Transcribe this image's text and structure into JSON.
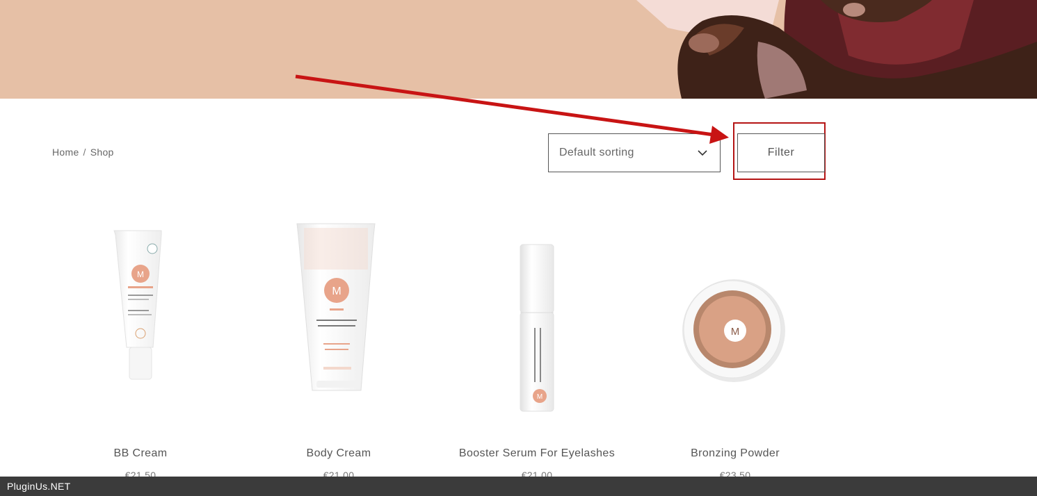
{
  "breadcrumb": {
    "home": "Home",
    "separator": "/",
    "current": "Shop"
  },
  "sorting": {
    "selected": "Default sorting"
  },
  "filter": {
    "label": "Filter"
  },
  "products": [
    {
      "title": "BB Cream",
      "price": "€21.50"
    },
    {
      "title": "Body Cream",
      "price": "€21.00"
    },
    {
      "title": "Booster Serum For Eyelashes",
      "price": "€21.00"
    },
    {
      "title": "Bronzing Powder",
      "price": "€23.50"
    }
  ],
  "footer": {
    "brand": "PluginUs.NET"
  },
  "colors": {
    "hero": "#e6c0a6",
    "annotation": "#c81414",
    "brand_pink": "#e8a48a",
    "footer": "#3b3b3b"
  },
  "icons": {
    "sort": "chevron-down-icon",
    "annotation": "red-arrow"
  }
}
